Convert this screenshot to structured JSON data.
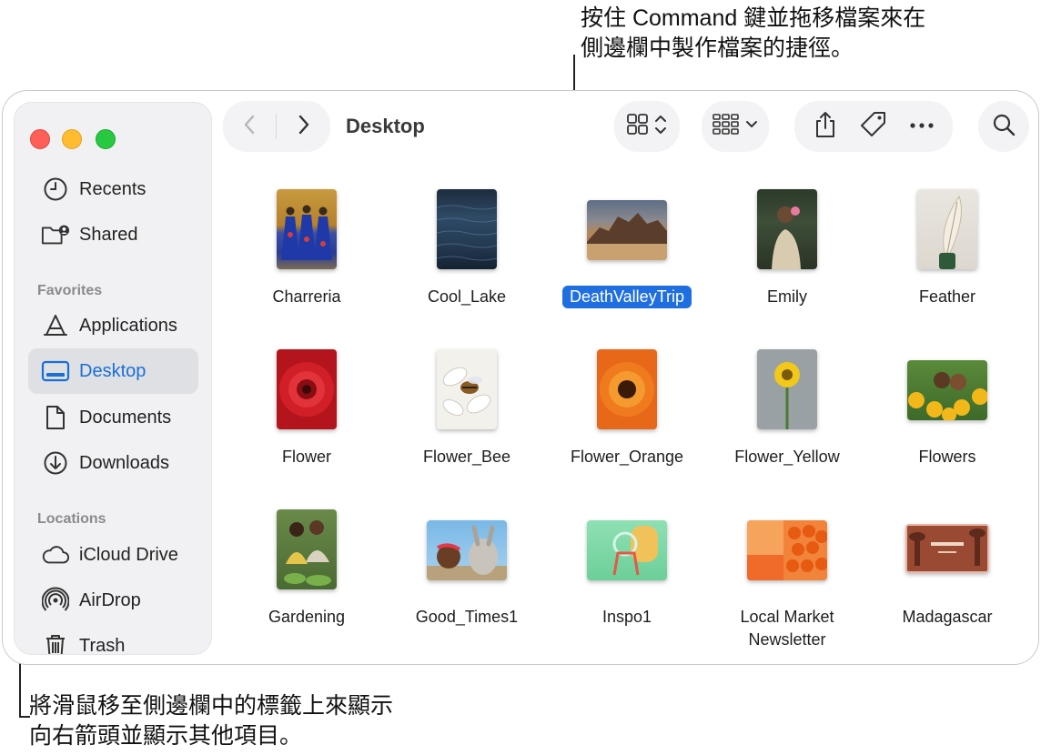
{
  "callouts": {
    "top_line1": "按住 Command 鍵並拖移檔案來在",
    "top_line2": "側邊欄中製作檔案的捷徑。",
    "bottom_line1": "將滑鼠移至側邊欄中的標籤上來顯示",
    "bottom_line2": "向右箭頭並顯示其他項目。"
  },
  "window": {
    "title": "Desktop"
  },
  "sidebar": {
    "items_top": [
      {
        "label": "Recents",
        "icon": "clock-icon"
      },
      {
        "label": "Shared",
        "icon": "shared-folder-icon"
      }
    ],
    "favorites_header": "Favorites",
    "favorites": [
      {
        "label": "Applications",
        "icon": "applications-icon"
      },
      {
        "label": "Desktop",
        "icon": "desktop-icon",
        "selected": true
      },
      {
        "label": "Documents",
        "icon": "document-icon"
      },
      {
        "label": "Downloads",
        "icon": "download-icon"
      }
    ],
    "locations_header": "Locations",
    "locations": [
      {
        "label": "iCloud Drive",
        "icon": "cloud-icon"
      },
      {
        "label": "AirDrop",
        "icon": "airdrop-icon"
      },
      {
        "label": "Trash",
        "icon": "trash-icon"
      }
    ]
  },
  "toolbar": {
    "back_icon": "chevron-left-icon",
    "forward_icon": "chevron-right-icon",
    "view_icon": "icon-grid-view-icon",
    "group_icon": "group-by-icon",
    "share_icon": "share-icon",
    "tag_icon": "tag-icon",
    "more_icon": "ellipsis-icon",
    "search_icon": "search-icon"
  },
  "files": [
    {
      "name": "Charreria"
    },
    {
      "name": "Cool_Lake"
    },
    {
      "name": "DeathValleyTrip",
      "selected": true
    },
    {
      "name": "Emily"
    },
    {
      "name": "Feather"
    },
    {
      "name": "Flower"
    },
    {
      "name": "Flower_Bee"
    },
    {
      "name": "Flower_Orange"
    },
    {
      "name": "Flower_Yellow"
    },
    {
      "name": "Flowers"
    },
    {
      "name": "Gardening"
    },
    {
      "name": "Good_Times1"
    },
    {
      "name": "Inspo1"
    },
    {
      "name": "Local Market Newsletter"
    },
    {
      "name": "Madagascar"
    }
  ],
  "colors": {
    "accent": "#1f6fe0",
    "close": "#fe5f57",
    "minimize": "#febc2e",
    "zoom": "#28c840"
  }
}
